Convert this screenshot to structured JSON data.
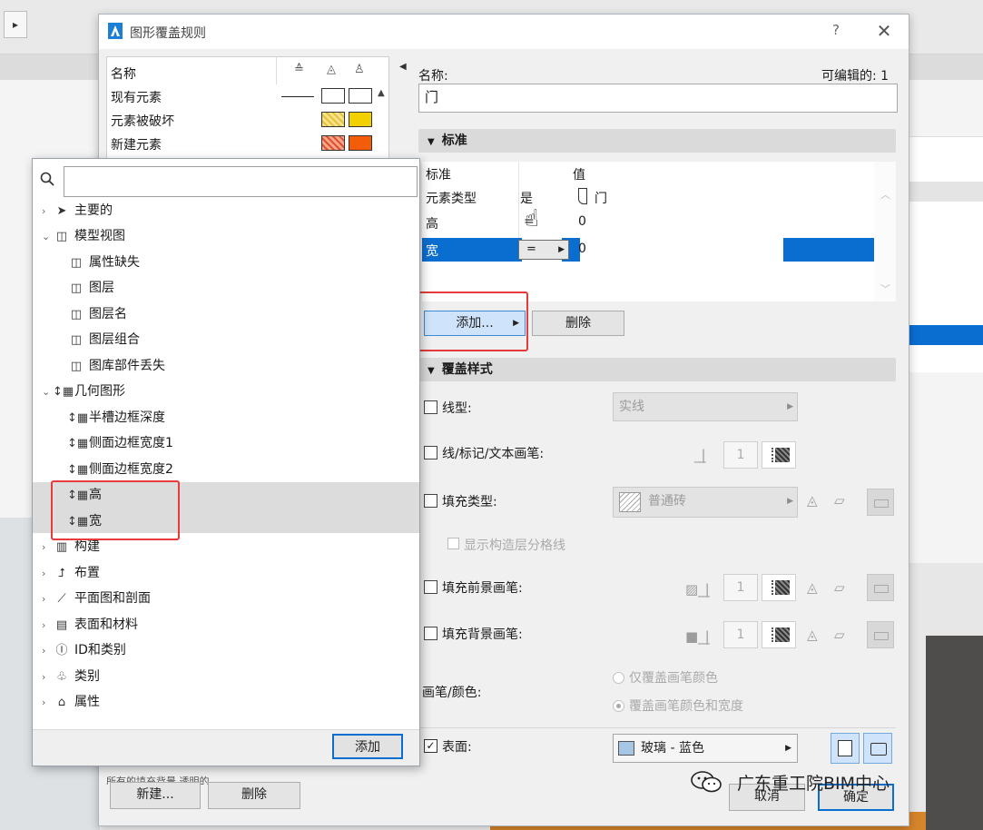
{
  "dialog": {
    "title": "图形覆盖规则",
    "help": "?",
    "close": "✕"
  },
  "rules_list": {
    "header": "名称",
    "rows": [
      {
        "name": "现有元素",
        "fg": "#ffffff",
        "bg": "#ffffff"
      },
      {
        "name": "元素被破坏",
        "fg": "#f3df6c",
        "bg": "#f3d000"
      },
      {
        "name": "新建元素",
        "fg": "#ef8a6a",
        "bg": "#f35d0a"
      }
    ]
  },
  "right": {
    "name_label": "名称:",
    "editable_label": "可编辑的:",
    "editable_count": "1",
    "name_value": "门",
    "section_criteria": "标准",
    "criteria": {
      "header_criteria": "标准",
      "header_value": "值",
      "rows": [
        {
          "criterion": "元素类型",
          "op": "是",
          "value": "门"
        },
        {
          "criterion": "高",
          "op": "=",
          "value": "0"
        },
        {
          "criterion": "宽",
          "op": "=",
          "value": "0"
        }
      ]
    },
    "add_label": "添加...",
    "delete_label": "删除",
    "section_override": "覆盖样式",
    "override": {
      "line_type_label": "线型:",
      "line_type_value": "实线",
      "pen_label": "线/标记/文本画笔:",
      "pen_value": "1",
      "fill_type_label": "填充类型:",
      "fill_type_value": "普通砖",
      "show_layer_lines": "显示构造层分格线",
      "fill_fg_label": "填充前景画笔:",
      "fill_fg_value": "1",
      "fill_bg_label": "填充背景画笔:",
      "fill_bg_value": "1",
      "pen_color_label": "画笔/颜色:",
      "radio_1": "仅覆盖画笔颜色",
      "radio_2": "覆盖画笔颜色和宽度",
      "surface_label": "表面:",
      "surface_value": "玻璃 - 蓝色"
    },
    "cancel": "取消",
    "ok": "确定"
  },
  "bottom_left": {
    "new": "新建...",
    "delete": "删除",
    "behind_text": "所有的填充背景    透明的"
  },
  "popup": {
    "search_placeholder": "",
    "tree": [
      {
        "label": "主要的",
        "level": 0,
        "expanded": false,
        "icon": "pointer-icon"
      },
      {
        "label": "模型视图",
        "level": 0,
        "expanded": true,
        "icon": "model-view-icon"
      },
      {
        "label": "属性缺失",
        "level": 1,
        "icon": "model-view-icon"
      },
      {
        "label": "图层",
        "level": 1,
        "icon": "model-view-icon"
      },
      {
        "label": "图层名",
        "level": 1,
        "icon": "model-view-icon"
      },
      {
        "label": "图层组合",
        "level": 1,
        "icon": "model-view-icon"
      },
      {
        "label": "图库部件丢失",
        "level": 1,
        "icon": "model-view-icon"
      },
      {
        "label": "几何图形",
        "level": 0,
        "expanded": true,
        "icon": "geometry-icon"
      },
      {
        "label": "半槽边框深度",
        "level": 1,
        "icon": "geometry-icon"
      },
      {
        "label": "侧面边框宽度1",
        "level": 1,
        "icon": "geometry-icon"
      },
      {
        "label": "侧面边框宽度2",
        "level": 1,
        "icon": "geometry-icon"
      },
      {
        "label": "高",
        "level": 1,
        "icon": "geometry-icon",
        "selected": true
      },
      {
        "label": "宽",
        "level": 1,
        "icon": "geometry-icon",
        "selected": true
      },
      {
        "label": "构建",
        "level": 0,
        "expanded": false,
        "icon": "construction-icon"
      },
      {
        "label": "布置",
        "level": 0,
        "expanded": false,
        "icon": "placement-icon"
      },
      {
        "label": "平面图和剖面",
        "level": 0,
        "expanded": false,
        "icon": "plan-section-icon"
      },
      {
        "label": "表面和材料",
        "level": 0,
        "expanded": false,
        "icon": "surface-material-icon"
      },
      {
        "label": "ID和类别",
        "level": 0,
        "expanded": false,
        "icon": "id-icon"
      },
      {
        "label": "类别",
        "level": 0,
        "expanded": false,
        "icon": "tree-class-icon"
      },
      {
        "label": "属性",
        "level": 0,
        "expanded": false,
        "icon": "tag-icon"
      }
    ],
    "add_button": "添加"
  },
  "watermark": {
    "text": "广东重工院BIM中心"
  },
  "colors": {
    "accent": "#0a6ed1",
    "highlight_red": "#e53b3b",
    "selection_gray": "#dcdcdc"
  }
}
